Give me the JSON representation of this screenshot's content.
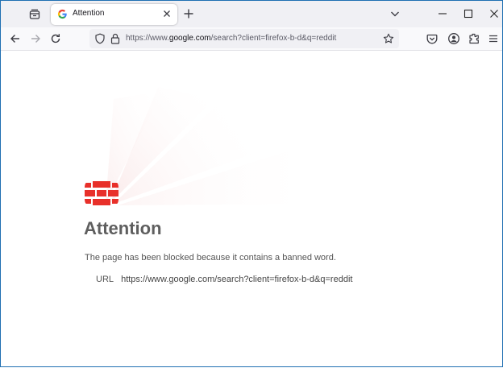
{
  "browser": {
    "tab": {
      "title": "Attention",
      "favicon": "google-g-icon"
    },
    "address_bar": {
      "url_prefix": "https://www.",
      "url_host": "google.com",
      "url_rest": "/search?client=firefox-b-d&q=reddit"
    },
    "icons": {
      "tab_list": "firefox-view-icon",
      "new_tab": "plus-icon",
      "list_all_tabs": "chevron-down-icon",
      "minimize": "minimize-icon",
      "maximize": "maximize-icon",
      "close": "close-icon",
      "back": "back-arrow-icon",
      "forward": "forward-arrow-icon",
      "reload": "reload-icon",
      "tracking_protection": "shield-icon",
      "security": "lock-icon",
      "bookmark": "star-icon",
      "pocket": "pocket-icon",
      "account": "account-icon",
      "extensions": "extensions-icon",
      "menu": "hamburger-menu-icon"
    }
  },
  "page": {
    "heading": "Attention",
    "message": "The page has been blocked because it contains a banned word.",
    "url_label": "URL",
    "url_value": "https://www.google.com/search?client=firefox-b-d&q=reddit"
  },
  "colors": {
    "brand_red": "#e8302a",
    "heading_gray": "#5f5f5f",
    "tab_strip_bg": "#f0f0f4"
  }
}
